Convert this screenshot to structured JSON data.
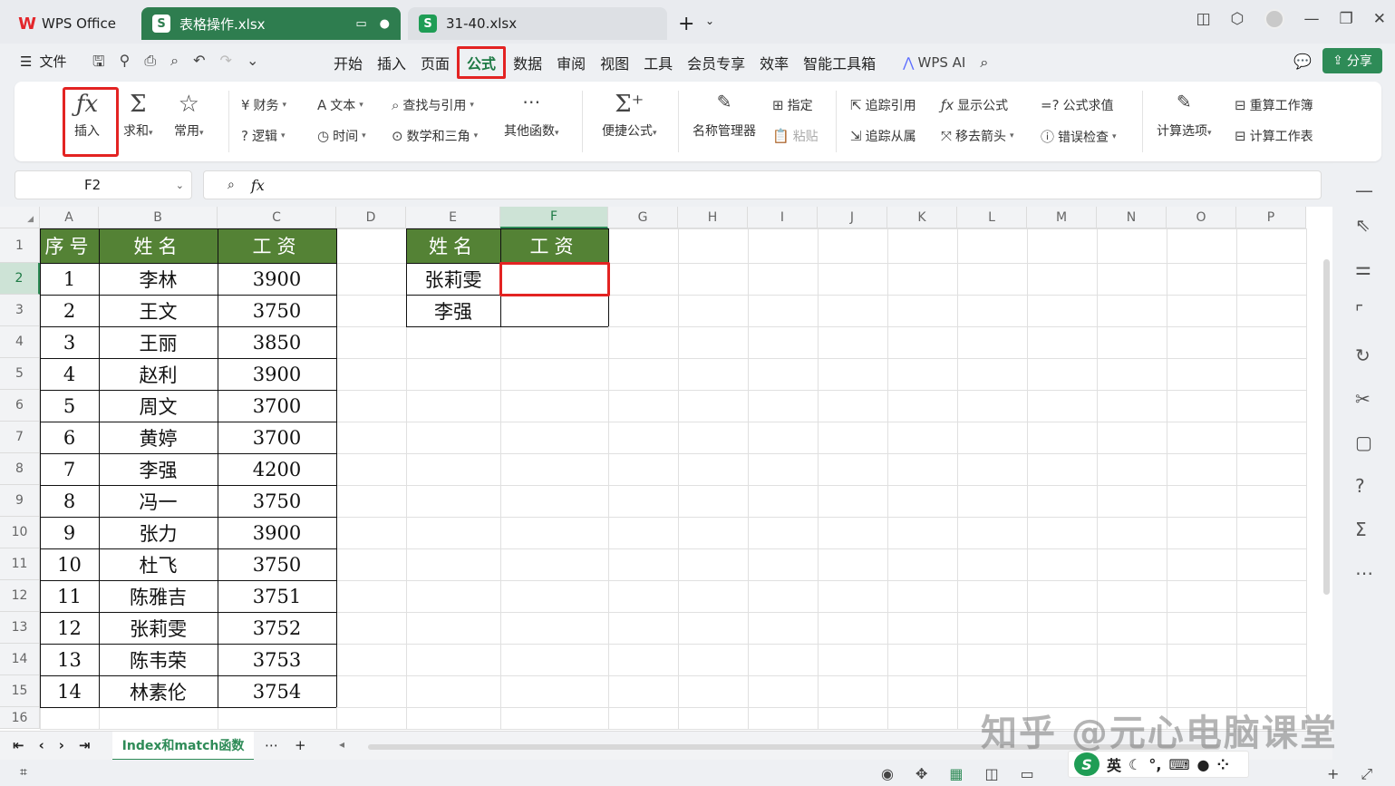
{
  "tabs": {
    "home": "WPS Office",
    "active_file": "表格操作.xlsx",
    "other_file": "31-40.xlsx",
    "new_tab": "+"
  },
  "menubar": {
    "file": "文件",
    "items": [
      "开始",
      "插入",
      "页面",
      "公式",
      "数据",
      "审阅",
      "视图",
      "工具",
      "会员专享",
      "效率",
      "智能工具箱"
    ],
    "active_item": "公式",
    "wps_ai": "WPS AI",
    "share": "分享"
  },
  "ribbon": {
    "insert_function": "插入",
    "sum": "求和",
    "common": "常用",
    "finance": "财务",
    "logic": "逻辑",
    "text": "文本",
    "time": "时间",
    "lookup": "查找与引用",
    "math": "数学和三角",
    "other_func": "其他函数",
    "quick_formula": "便捷公式",
    "name_manager": "名称管理器",
    "define": "指定",
    "paste": "粘贴",
    "trace_precedents": "追踪引用",
    "trace_dependents": "追踪从属",
    "show_formulas": "显示公式",
    "remove_arrows": "移去箭头",
    "evaluate": "公式求值",
    "error_check": "错误检查",
    "calc_options": "计算选项",
    "recalc_workbook": "重算工作簿",
    "calc_sheet": "计算工作表"
  },
  "formula_bar": {
    "name_box": "F2",
    "fx": "fx",
    "content": ""
  },
  "columns": [
    "A",
    "B",
    "C",
    "D",
    "E",
    "F",
    "G",
    "H",
    "I",
    "J",
    "K",
    "L",
    "M",
    "N",
    "O",
    "P"
  ],
  "selected_column": "F",
  "rows": [
    "1",
    "2",
    "3",
    "4",
    "5",
    "6",
    "7",
    "8",
    "9",
    "10",
    "11",
    "12",
    "13",
    "14",
    "15",
    "16"
  ],
  "selected_row": "2",
  "table_main": {
    "headers": [
      "序号",
      "姓名",
      "工资"
    ],
    "rows": [
      [
        "1",
        "李林",
        "3900"
      ],
      [
        "2",
        "王文",
        "3750"
      ],
      [
        "3",
        "王丽",
        "3850"
      ],
      [
        "4",
        "赵利",
        "3900"
      ],
      [
        "5",
        "周文",
        "3700"
      ],
      [
        "6",
        "黄婷",
        "3700"
      ],
      [
        "7",
        "李强",
        "4200"
      ],
      [
        "8",
        "冯一",
        "3750"
      ],
      [
        "9",
        "张力",
        "3900"
      ],
      [
        "10",
        "杜飞",
        "3750"
      ],
      [
        "11",
        "陈雅吉",
        "3751"
      ],
      [
        "12",
        "张莉雯",
        "3752"
      ],
      [
        "13",
        "陈韦荣",
        "3753"
      ],
      [
        "14",
        "林素伦",
        "3754"
      ]
    ]
  },
  "table_lookup": {
    "headers": [
      "姓名",
      "工资"
    ],
    "rows": [
      [
        "张莉雯",
        ""
      ],
      [
        "李强",
        ""
      ]
    ]
  },
  "sheet_tab": "Index和match函数",
  "watermark": "知乎 @元心电脑课堂",
  "ime": {
    "logo": "S",
    "lang": "英"
  },
  "colors": {
    "accent": "#2e8b57",
    "header_fill": "#548235",
    "highlight": "#e32322"
  }
}
